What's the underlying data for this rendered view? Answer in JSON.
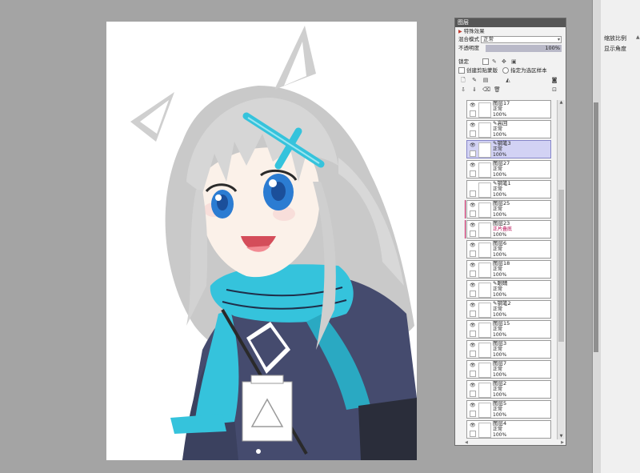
{
  "layer_panel": {
    "title": "图层",
    "effects_label": "特殊效果",
    "blend_mode_label": "混合模式",
    "blend_mode_value": "正常",
    "opacity_label": "不透明度",
    "opacity_value": "100%",
    "lock_label": "锁定",
    "create_clipping_label": "创建剪贴蒙版",
    "specify_selection_source_label": "指定为选区样本",
    "layers": [
      {
        "name": "图层17",
        "mode": "正常",
        "opacity": "100%",
        "visible": true
      },
      {
        "name": "高回",
        "mode": "正常",
        "opacity": "100%",
        "visible": true,
        "pen": true
      },
      {
        "name": "钢笔3",
        "mode": "正常",
        "opacity": "100%",
        "visible": true,
        "pen": true,
        "active": true
      },
      {
        "name": "图层27",
        "mode": "正常",
        "opacity": "100%",
        "visible": true
      },
      {
        "name": "钢笔1",
        "mode": "正常",
        "opacity": "100%",
        "visible": false,
        "pen": true
      },
      {
        "name": "图层25",
        "mode": "正常",
        "opacity": "100%",
        "visible": true,
        "clip": true
      },
      {
        "name": "图层23",
        "mode": "正片叠底",
        "opacity": "100%",
        "visible": true,
        "clip": true
      },
      {
        "name": "图层6",
        "mode": "正常",
        "opacity": "100%",
        "visible": true
      },
      {
        "name": "图层18",
        "mode": "正常",
        "opacity": "100%",
        "visible": true
      },
      {
        "name": "眼睛",
        "mode": "正常",
        "opacity": "100%",
        "visible": true,
        "pen": true
      },
      {
        "name": "钢笔2",
        "mode": "正常",
        "opacity": "100%",
        "visible": true,
        "pen": true
      },
      {
        "name": "图层15",
        "mode": "正常",
        "opacity": "100%",
        "visible": true
      },
      {
        "name": "图层3",
        "mode": "正常",
        "opacity": "100%",
        "visible": true
      },
      {
        "name": "图层7",
        "mode": "正常",
        "opacity": "100%",
        "visible": true
      },
      {
        "name": "图层2",
        "mode": "正常",
        "opacity": "100%",
        "visible": true
      },
      {
        "name": "图层5",
        "mode": "正常",
        "opacity": "100%",
        "visible": true
      },
      {
        "name": "图层4",
        "mode": "正常",
        "opacity": "100%",
        "visible": true
      }
    ]
  },
  "right_panel": {
    "zoom_label": "缩放比例",
    "rotation_label": "显示角度"
  },
  "colors": {
    "hair": "#d6d6d6",
    "scarf": "#35c3dc",
    "jacket": "#454b6e",
    "eye": "#2b7cd2",
    "active_layer": "#d2d2f4",
    "clip_marker": "#c2185b"
  }
}
